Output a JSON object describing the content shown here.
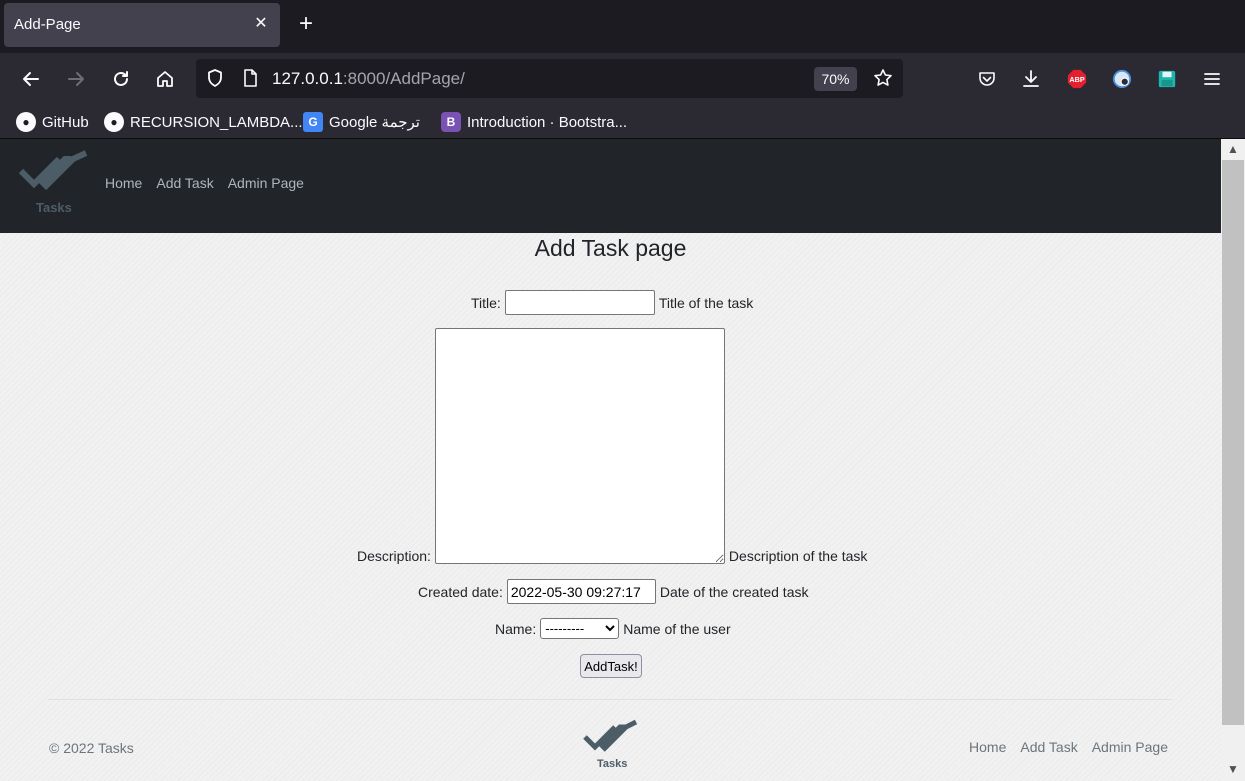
{
  "browser": {
    "tab_title": "Add-Page",
    "tab_close_glyph": "✕",
    "new_tab_glyph": "+",
    "url_host": "127.0.0.1",
    "url_rest": ":8000/AddPage/",
    "zoom": "70%",
    "bookmarks": [
      {
        "label": "GitHub",
        "icon": "github-icon"
      },
      {
        "label": "RECURSION_LAMBDA...",
        "icon": "github-icon"
      },
      {
        "label": "Google ترجمة",
        "icon": "google-translate-icon"
      },
      {
        "label": "Introduction · Bootstra...",
        "icon": "bootstrap-icon"
      }
    ],
    "toolbar_icons": [
      "pocket-icon",
      "download-icon",
      "adblock-plus-icon",
      "extension-icon",
      "save-icon",
      "menu-icon"
    ],
    "colors": {
      "abp": "#e4202e",
      "save": "#1fb5ad",
      "bootstrap": "#7952b3"
    }
  },
  "site": {
    "logo_text": "Tasks",
    "nav": [
      "Home",
      "Add Task",
      "Admin Page"
    ]
  },
  "form": {
    "page_title": "Add Task page",
    "title_label": "Title:",
    "title_value": "",
    "title_help": "Title of the task",
    "description_label": "Description:",
    "description_value": "",
    "description_help": "Description of the task",
    "created_label": "Created date:",
    "created_value": "2022-05-30 09:27:17",
    "created_help": "Date of the created task",
    "name_label": "Name:",
    "name_selected": "---------",
    "name_help": "Name of the user",
    "submit_label": "AddTask!"
  },
  "footer": {
    "copyright": "© 2022 Tasks",
    "logo_text": "Tasks",
    "nav": [
      "Home",
      "Add Task",
      "Admin Page"
    ]
  }
}
